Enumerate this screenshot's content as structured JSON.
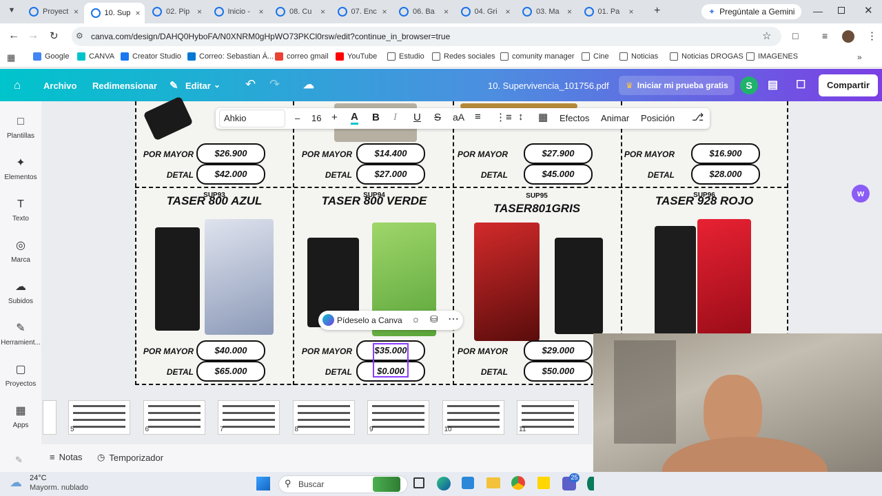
{
  "browser": {
    "tabs": [
      {
        "label": "Proyect"
      },
      {
        "label": "10. Sup"
      },
      {
        "label": "02. Pip"
      },
      {
        "label": "Inicio -"
      },
      {
        "label": "08. Cu"
      },
      {
        "label": "07. Enc"
      },
      {
        "label": "06. Ba"
      },
      {
        "label": "04. Gri"
      },
      {
        "label": "03. Ma"
      },
      {
        "label": "01. Pa"
      }
    ],
    "new_tab": "+",
    "gemini": "Pregúntale a Gemini",
    "url": "canva.com/design/DAHQ0HyboFA/N0XNRM0gHpWO73PKCl0rsw/edit?continue_in_browser=true",
    "bookmarks": [
      {
        "label": "Google",
        "color": "#4285f4"
      },
      {
        "label": "CANVA",
        "color": "#00c4cc"
      },
      {
        "label": "Creator Studio",
        "color": "#1877f2"
      },
      {
        "label": "Correo: Sebastian Á...",
        "color": "#0078d4"
      },
      {
        "label": "correo gmail",
        "color": "#ea4335"
      },
      {
        "label": "YouTube",
        "color": "#ff0000"
      },
      {
        "label": "Estudio",
        "color": "#555555"
      },
      {
        "label": "Redes sociales",
        "color": "#555555"
      },
      {
        "label": "comunity manager",
        "color": "#555555"
      },
      {
        "label": "Cine",
        "color": "#555555"
      },
      {
        "label": "Noticias",
        "color": "#555555"
      },
      {
        "label": "Noticias DROGAS",
        "color": "#555555"
      },
      {
        "label": "IMAGENES",
        "color": "#555555"
      }
    ]
  },
  "canva": {
    "menu": {
      "archivo": "Archivo",
      "redimensionar": "Redimensionar",
      "editar": "Editar"
    },
    "doc_title": "10. Supervivencia_101756.pdf",
    "trial": "Iniciar mi prueba gratis",
    "avatar": "S",
    "share": "Compartir",
    "sidebar": [
      {
        "label": "Plantillas",
        "icon": "templates-icon"
      },
      {
        "label": "Elementos",
        "icon": "elements-icon"
      },
      {
        "label": "Texto",
        "icon": "text-icon"
      },
      {
        "label": "Marca",
        "icon": "brand-icon"
      },
      {
        "label": "Subidos",
        "icon": "uploads-icon"
      },
      {
        "label": "Herramient...",
        "icon": "tools-icon"
      },
      {
        "label": "Proyectos",
        "icon": "projects-icon"
      },
      {
        "label": "Apps",
        "icon": "apps-icon"
      }
    ],
    "toolbar": {
      "font": "Ahkio",
      "size": "16",
      "minus": "–",
      "plus": "+",
      "letter_a": "A",
      "bold": "B",
      "italic": "I",
      "underline": "U",
      "strike": "S",
      "case": "aA",
      "effects": "Efectos",
      "animate": "Animar",
      "position": "Posición"
    },
    "products_top": [
      {
        "mayor": "$26.900",
        "detal": "$42.000"
      },
      {
        "mayor": "$14.400",
        "detal": "$27.000"
      },
      {
        "mayor": "$27.900",
        "detal": "$45.000"
      },
      {
        "mayor": "$16.900",
        "detal": "$28.000"
      }
    ],
    "products_bottom": [
      {
        "code": "SUP93",
        "title": "TASER 800 AZUL",
        "mayor": "$40.000",
        "detal": "$65.000"
      },
      {
        "code": "SUP94",
        "title": "TASER 800 VERDE",
        "mayor": "$35.000",
        "detal": "$0.000"
      },
      {
        "code": "SUP95",
        "title": "TASER801GRIS",
        "mayor": "$29.000",
        "detal": "$50.000"
      },
      {
        "code": "SUP96",
        "title": "TASER 928 ROJO",
        "mayor": "",
        "detal": ""
      }
    ],
    "labels": {
      "mayor": "POR MAYOR",
      "detal": "DETAL"
    },
    "assistant": "Pídeselo a Canva",
    "pages": [
      "5",
      "6",
      "7",
      "8",
      "9",
      "10",
      "11"
    ],
    "footer": {
      "notes": "Notas",
      "timer": "Temporizador"
    }
  },
  "taskbar": {
    "temp": "24°C",
    "weather": "Mayorm. nublado",
    "search": "Buscar",
    "badge": "25"
  }
}
